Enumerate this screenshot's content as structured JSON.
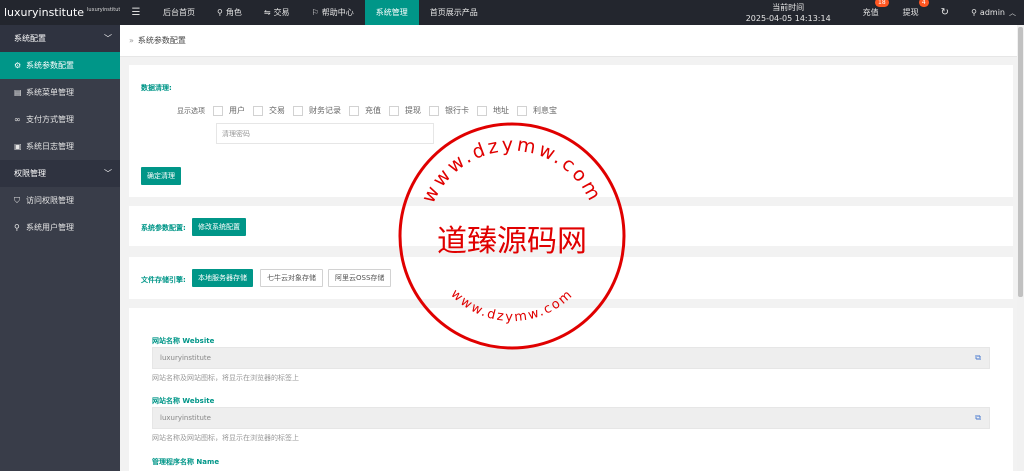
{
  "app": {
    "logo_main": "luxuryinstitute",
    "logo_sup": "luxuryinstitute"
  },
  "topnav": {
    "menu_icon": "menu-icon",
    "items": [
      {
        "label": "后台首页",
        "icon": ""
      },
      {
        "label": "角色",
        "icon": "user-icon"
      },
      {
        "label": "交易",
        "icon": "exchange-icon"
      },
      {
        "label": "帮助中心",
        "icon": "flag-icon"
      },
      {
        "label": "系统管理",
        "icon": "",
        "active": true
      },
      {
        "label": "首页展示产品",
        "icon": ""
      }
    ],
    "clock_label": "当前时间",
    "clock_value": "2025-04-05 14:13:14",
    "recharge_label": "充值",
    "recharge_badge": "18",
    "withdraw_label": "提现",
    "withdraw_badge": "4",
    "refresh_icon": "refresh-icon",
    "user_name": "admin"
  },
  "sidebar": {
    "groups": [
      {
        "label": "系统配置",
        "items": [
          {
            "label": "系统参数配置",
            "icon": "gear-icon",
            "active": true
          },
          {
            "label": "系统菜单管理",
            "icon": "table-icon"
          },
          {
            "label": "支付方式管理",
            "icon": "link-icon"
          },
          {
            "label": "系统日志管理",
            "icon": "log-icon"
          }
        ]
      },
      {
        "label": "权限管理",
        "items": [
          {
            "label": "访问权限管理",
            "icon": "shield-icon"
          },
          {
            "label": "系统用户管理",
            "icon": "user-icon"
          }
        ]
      }
    ]
  },
  "breadcrumb": {
    "text": "系统参数配置"
  },
  "data_clear": {
    "title": "数据清理:",
    "show_label": "显示选项",
    "options": [
      "用户",
      "交易",
      "财务记录",
      "充值",
      "提现",
      "银行卡",
      "地址",
      "利息宝"
    ],
    "password_placeholder": "清理密码",
    "confirm_label": "确定清理"
  },
  "sys_config": {
    "title": "系统参数配置:",
    "edit_label": "修改系统配置"
  },
  "storage": {
    "title": "文件存储引擎:",
    "options": [
      {
        "label": "本地服务器存储",
        "active": true
      },
      {
        "label": "七牛云对象存储",
        "active": false
      },
      {
        "label": "阿里云OSS存储",
        "active": false
      }
    ]
  },
  "fields": [
    {
      "label": "网站名称 Website",
      "value": "luxuryinstitute",
      "help": "网站名称及网站图标，将显示在浏览器的标签上"
    },
    {
      "label": "网站名称 Website",
      "value": "luxuryinstitute",
      "help": "网站名称及网站图标，将显示在浏览器的标签上"
    },
    {
      "label": "管理程序名称 Name"
    }
  ],
  "watermark": {
    "top_text": "www.dzymw.com",
    "center_text": "道臻源码网",
    "bottom_text": "www.dzymw.com",
    "color": "#e00000"
  },
  "colors": {
    "accent": "#009688",
    "topbar": "#23262e",
    "sidebar": "#393d49",
    "badge": "#ff5722"
  }
}
